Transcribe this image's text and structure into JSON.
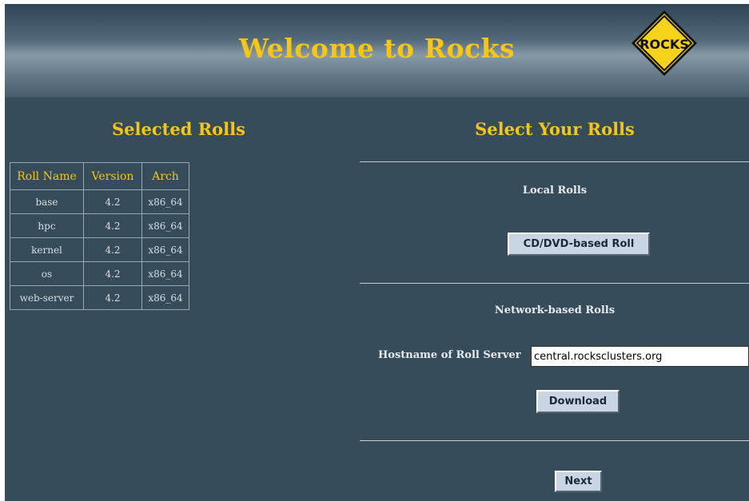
{
  "header": {
    "title": "Welcome to Rocks",
    "logo_text": "ROCKS"
  },
  "left": {
    "title": "Selected Rolls",
    "table": {
      "columns": [
        "Roll Name",
        "Version",
        "Arch"
      ],
      "rows": [
        [
          "base",
          "4.2",
          "x86_64"
        ],
        [
          "hpc",
          "4.2",
          "x86_64"
        ],
        [
          "kernel",
          "4.2",
          "x86_64"
        ],
        [
          "os",
          "4.2",
          "x86_64"
        ],
        [
          "web-server",
          "4.2",
          "x86_64"
        ]
      ]
    }
  },
  "right": {
    "title": "Select Your Rolls",
    "local_label": "Local Rolls",
    "cd_button": "CD/DVD-based Roll",
    "network_label": "Network-based Rolls",
    "hostname_label": "Hostname of Roll Server",
    "hostname_value": "central.rocksclusters.org",
    "download_button": "Download",
    "next_button": "Next"
  },
  "colors": {
    "background": "#374c5a",
    "title_yellow": "#f5c518",
    "logo_yellow": "#f6d21a",
    "button": "#c9d5e3"
  }
}
